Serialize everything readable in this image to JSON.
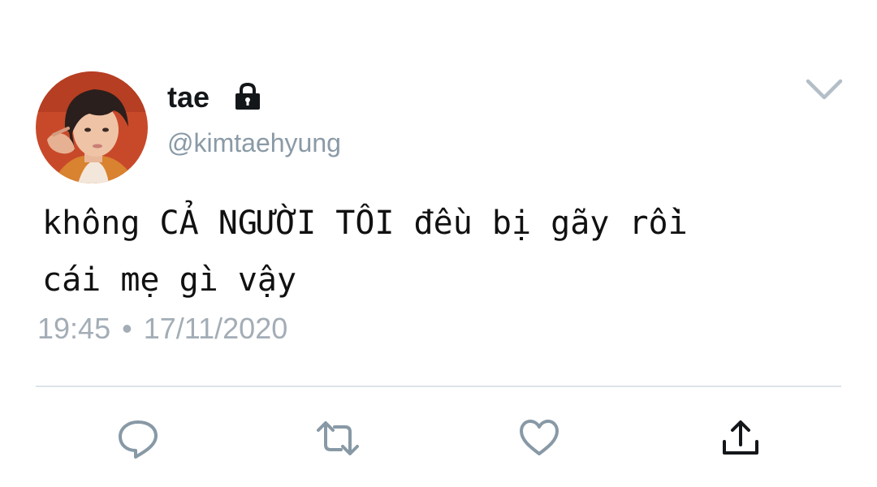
{
  "tweet": {
    "author": {
      "display_name": "tae",
      "handle": "@kimtaehyung",
      "protected_icon": "lock-icon"
    },
    "menu_icon": "chevron-down-icon",
    "text": "không CẢ NGƯỜI TÔI đều bị gãy rồi\ncái mẹ gì vậy",
    "time": "19:45",
    "separator": "•",
    "date": "17/11/2020"
  },
  "actions": [
    {
      "name": "reply",
      "icon": "reply-icon"
    },
    {
      "name": "retweet",
      "icon": "retweet-icon"
    },
    {
      "name": "like",
      "icon": "heart-icon"
    },
    {
      "name": "share",
      "icon": "share-icon"
    }
  ],
  "colors": {
    "name_text": "#14171a",
    "secondary_text": "#8a9aa6",
    "timestamp_text": "#a3adb6",
    "icon_gray": "#8899a6",
    "divider": "#dde3e8",
    "avatar_bg": "#c8492a"
  }
}
